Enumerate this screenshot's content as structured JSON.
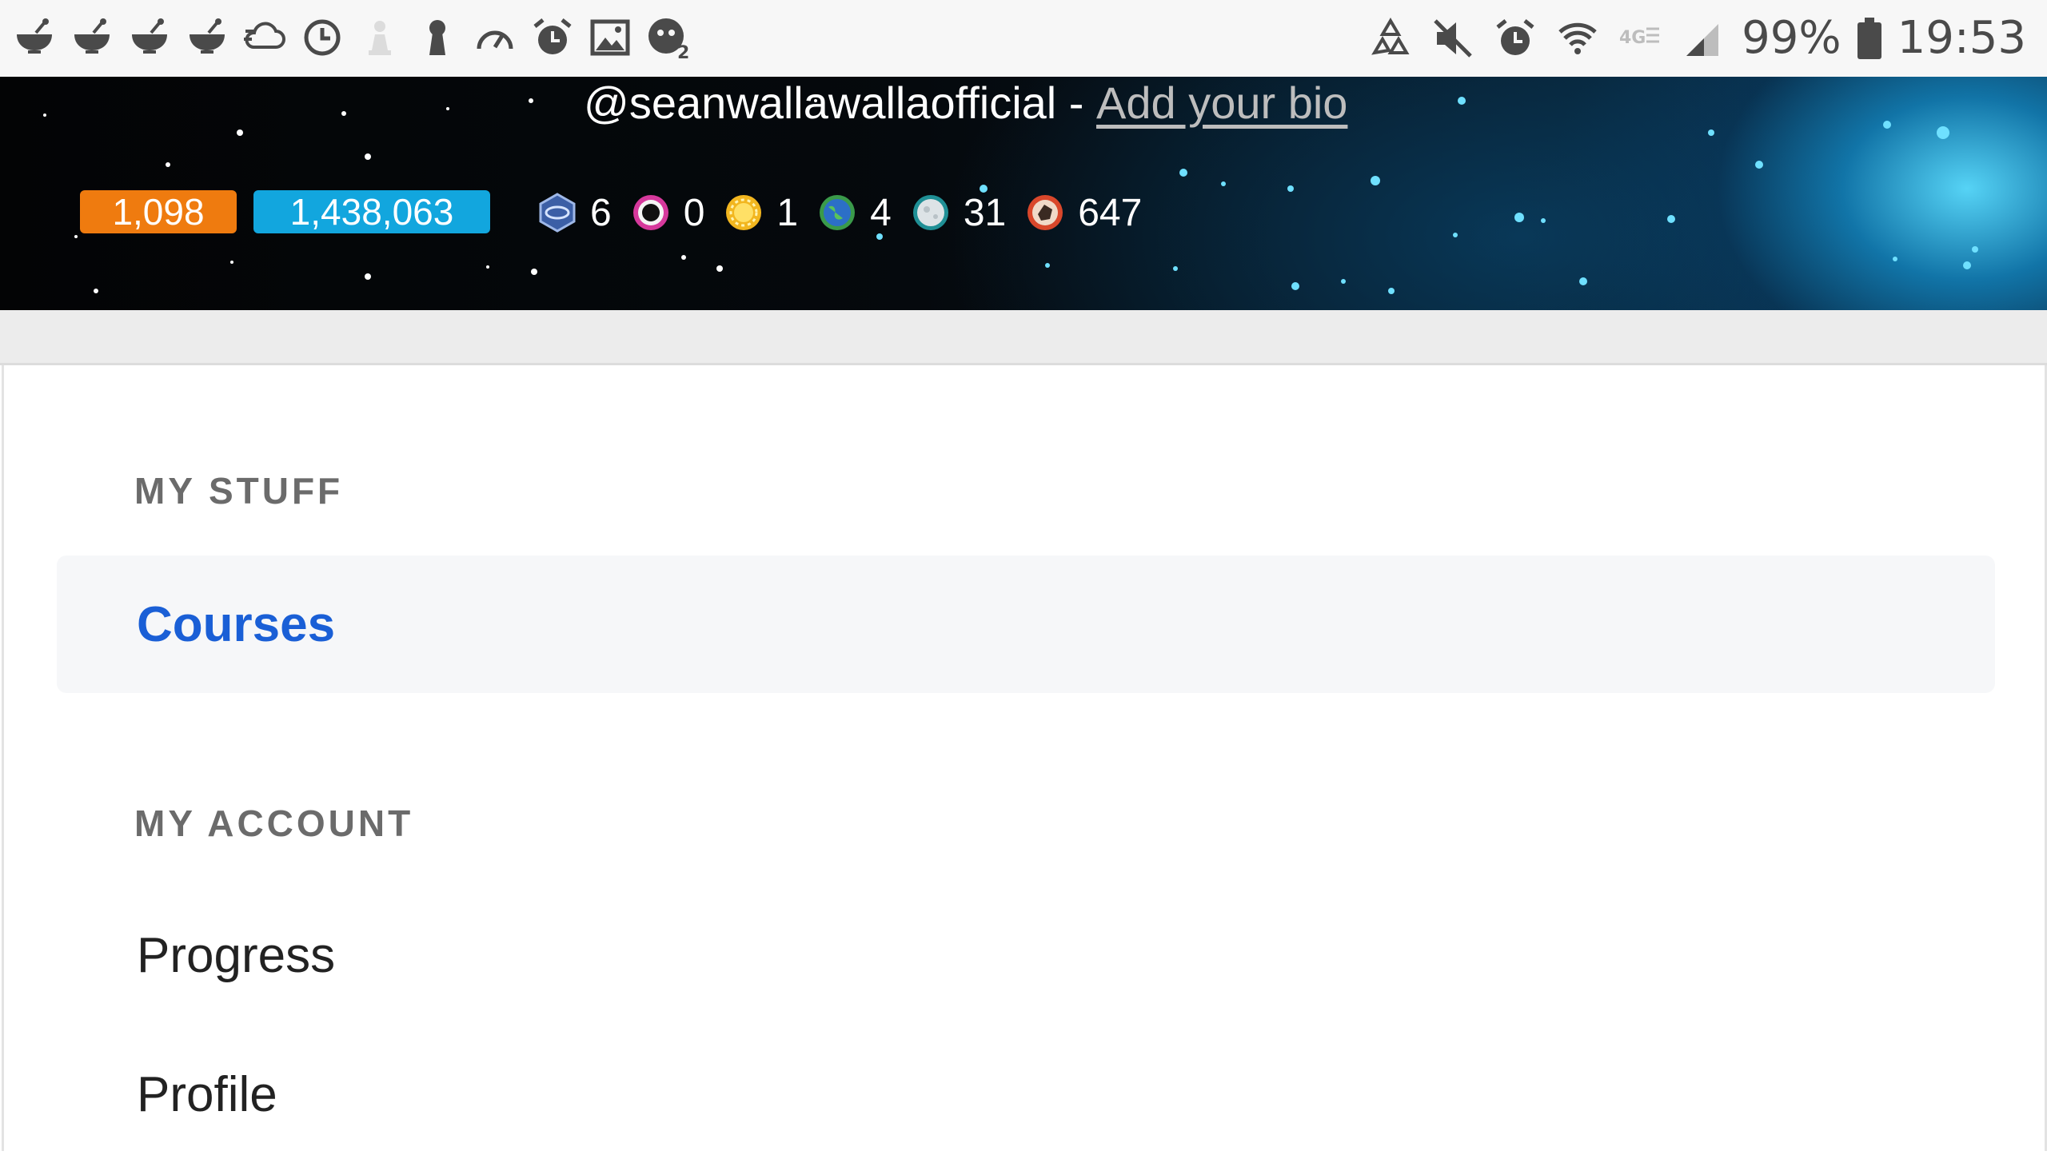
{
  "status_bar": {
    "left_icons": [
      "recipe-bowl-icon",
      "recipe-bowl-icon",
      "recipe-bowl-icon",
      "recipe-bowl-icon",
      "cloud-sync-icon",
      "clock-icon",
      "chess-pawn-icon",
      "keyhole-icon",
      "speedometer-icon",
      "alarm-icon",
      "image-icon",
      "emoji-face-icon"
    ],
    "right_icons": [
      "recycle-icon",
      "mute-icon",
      "alarm-icon",
      "wifi-icon",
      "lte-icon",
      "signal-icon"
    ],
    "battery": "99%",
    "time": "19:53"
  },
  "profile": {
    "handle": "@seanwallawallaofficial",
    "separator": " - ",
    "bio_link": "Add your bio",
    "badge_orange": "1,098",
    "badge_blue": "1,438,063",
    "stats": [
      {
        "icon": "planet-emblem-icon",
        "value": "6"
      },
      {
        "icon": "black-hole-icon",
        "value": "0"
      },
      {
        "icon": "sun-icon",
        "value": "1"
      },
      {
        "icon": "earth-icon",
        "value": "4"
      },
      {
        "icon": "moon-icon",
        "value": "31"
      },
      {
        "icon": "asteroid-icon",
        "value": "647"
      }
    ]
  },
  "menu": {
    "my_stuff_heading": "MY STUFF",
    "courses": "Courses",
    "my_account_heading": "MY ACCOUNT",
    "progress": "Progress",
    "profile": "Profile"
  },
  "colors": {
    "orange_badge": "#ef7b0f",
    "blue_badge": "#12a6de",
    "active_link": "#1a5fd6"
  }
}
